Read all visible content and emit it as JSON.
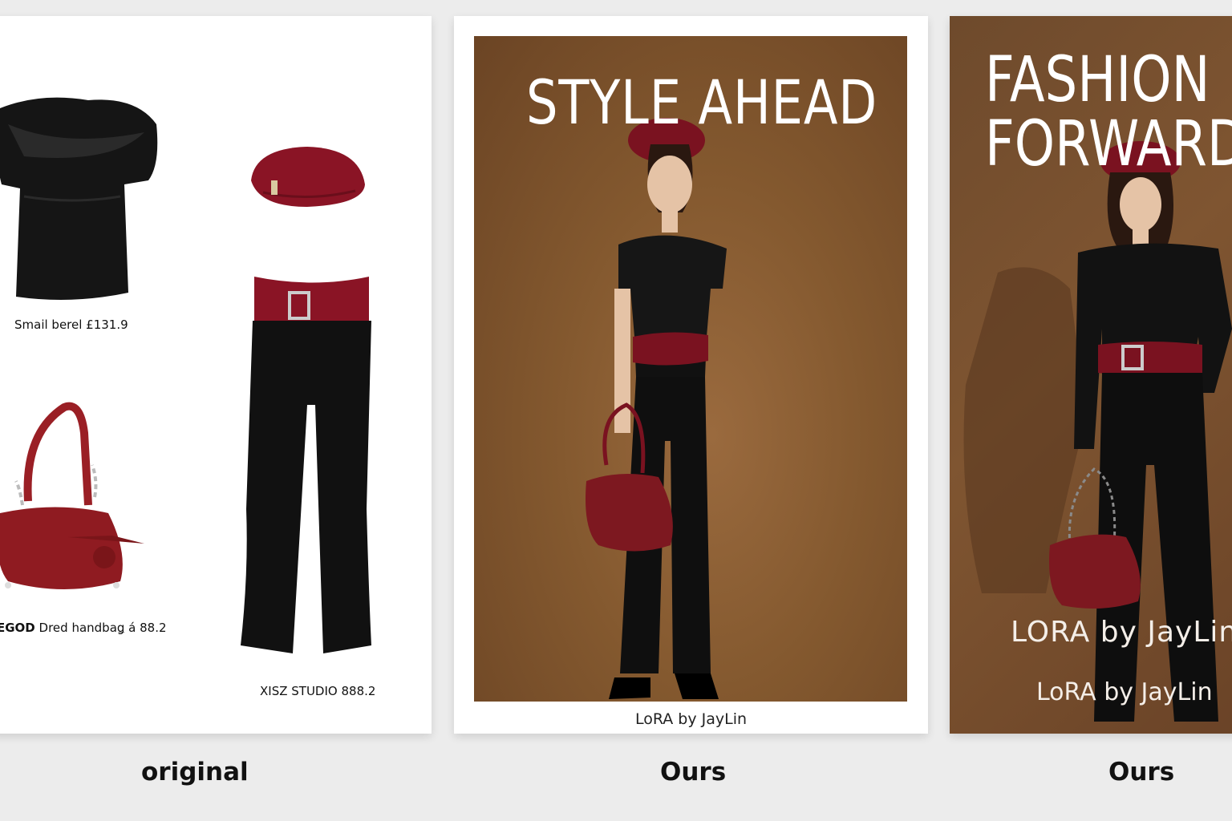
{
  "panels": {
    "original": {
      "caption": "original",
      "items": [
        {
          "name": "top",
          "label": "Smail berel £131.9"
        },
        {
          "name": "beret",
          "label": ""
        },
        {
          "name": "handbag",
          "brand": "EGOD",
          "label": "Dred handbaǥ á 88.2"
        },
        {
          "name": "trousers",
          "label": "XISZ STUDIO 888.2"
        }
      ]
    },
    "ours_1": {
      "caption": "Ours",
      "title": "STYLE AHEAD",
      "credit": "LoRA by JayLin"
    },
    "ours_2": {
      "caption": "Ours",
      "title_line1": "FASHION",
      "title_line2": "FORWARD",
      "credit_large": "LORA by JayLin",
      "credit_small": "LoRA by JayLin"
    }
  },
  "colors": {
    "burgundy": "#7e1420",
    "black": "#111111",
    "backdrop": "#84592f"
  }
}
